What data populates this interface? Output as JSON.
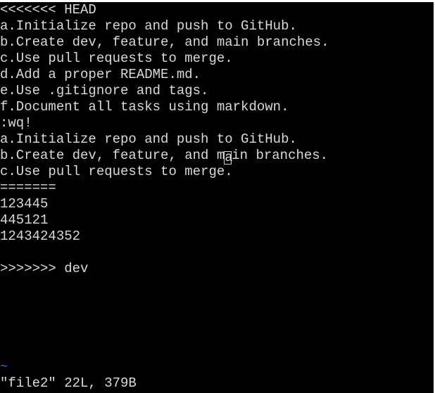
{
  "vim": {
    "lines": [
      "<<<<<<< HEAD",
      "a.Initialize repo and push to GitHub.",
      "b.Create dev, feature, and main branches.",
      "c.Use pull requests to merge.",
      "d.Add a proper README.md.",
      "e.Use .gitignore and tags.",
      "f.Document all tasks using markdown.",
      ":wq!",
      "a.Initialize repo and push to GitHub.",
      "b.Create dev, feature, and m",
      "a",
      "in branches.",
      "c.Use pull requests to merge.",
      "=======",
      "123445",
      "445121",
      "1243424352",
      "",
      ">>>>>>> dev"
    ],
    "empty_line_marker": "~",
    "status_line": "\"file2\" 22L, 379B"
  }
}
